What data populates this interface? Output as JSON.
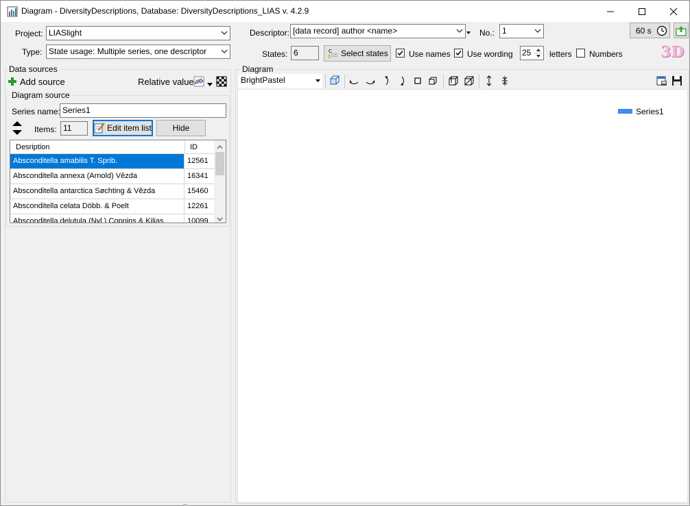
{
  "window": {
    "title": "Diagram - DiversityDescriptions,  Database: DiversityDescriptions_LIAS    v. 4.2.9",
    "minimize": "—",
    "maximize": "☐",
    "close": "✕"
  },
  "top": {
    "project_label": "Project:",
    "project_value": "LIASlight",
    "type_label": "Type:",
    "type_value": "State usage: Multiple series, one descriptor",
    "descriptor_label": "Descriptor:",
    "descriptor_value": "[data record] author <name>",
    "no_label": "No.:",
    "no_value": "1",
    "timer_label": "60 s",
    "states_label": "States:",
    "states_value": "6",
    "select_states_label": "Select states",
    "use_names_label": "Use names",
    "use_names_checked": true,
    "use_wording_label": "Use wording",
    "use_wording_checked": true,
    "letters_value": "25",
    "letters_label": "letters",
    "numbers_label": "Numbers",
    "numbers_checked": false,
    "three_d_label": "3D"
  },
  "data_sources": {
    "group_title": "Data sources",
    "add_source_label": "Add source",
    "relative_values_label": "Relative values",
    "diagram_source_title": "Diagram source",
    "series_name_label": "Series name:",
    "series_name_value": "Series1",
    "items_label": "Items:",
    "items_value": "11",
    "edit_item_list_label": "Edit item list",
    "hide_label": "Hide",
    "grid": {
      "columns": [
        "Desription",
        "ID"
      ],
      "rows": [
        {
          "name": "Absconditella amabilis T. Sprib.",
          "id": "12561"
        },
        {
          "name": "Absconditella annexa (Arnold) Vězda",
          "id": "16341"
        },
        {
          "name": "Absconditella antarctica Søchting & Vězda",
          "id": "15460"
        },
        {
          "name": "Absconditella celata Döbb. & Poelt",
          "id": "12261"
        },
        {
          "name": "Absconditella delutula (Nyl.) Coppins & Kilias",
          "id": "10099"
        }
      ]
    }
  },
  "diagram": {
    "group_title": "Diagram",
    "palette_value": "BrightPastel",
    "legend": [
      {
        "name": "Series1",
        "color": "#418cf0"
      }
    ]
  },
  "colors": {
    "selection": "#0078d7",
    "accent_3d": "#e8a0c8"
  }
}
